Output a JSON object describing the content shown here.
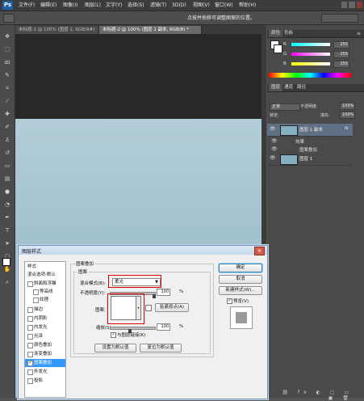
{
  "app": {
    "logo": "Ps"
  },
  "menu": [
    "文件(F)",
    "编辑(E)",
    "图像(I)",
    "图层(L)",
    "文字(Y)",
    "选择(S)",
    "滤镜(T)",
    "3D(D)",
    "视图(V)",
    "窗口(W)",
    "帮助(H)"
  ],
  "options_hint": "点按并拖移可调整图案的位置。",
  "doc_tabs": [
    "未标题-1 @ 100% (图层 1, RGB/8#)",
    "未标题-2 @ 100% (图层 1 副本, RGB/8) *"
  ],
  "color_panel": {
    "tabs": [
      "颜色",
      "色板"
    ],
    "rows": [
      {
        "letter": "R",
        "value": "255"
      },
      {
        "letter": "G",
        "value": "255"
      },
      {
        "letter": "B",
        "value": "255"
      }
    ]
  },
  "layers_panel": {
    "tabs": [
      "图层",
      "通道",
      "路径"
    ],
    "blend_mode": "正常",
    "opacity_label": "不透明度:",
    "opacity_value": "100%",
    "lock_label": "锁定:",
    "fill_label": "填充:",
    "fill_value": "100%",
    "layers": [
      {
        "name": "图层 1 副本",
        "fx": "fx",
        "selected": true
      },
      {
        "name": "效果",
        "indent": true
      },
      {
        "name": "图案叠加",
        "indent": true
      },
      {
        "name": "图层 1",
        "selected": false
      }
    ]
  },
  "dialog": {
    "title": "图层样式",
    "styles_header": "样式",
    "styles_sub": "混合选项:默认",
    "styles": [
      {
        "label": "斜面和浮雕",
        "checked": false
      },
      {
        "label": "等高线",
        "checked": false,
        "indent": true
      },
      {
        "label": "纹理",
        "checked": false,
        "indent": true
      },
      {
        "label": "描边",
        "checked": false
      },
      {
        "label": "内阴影",
        "checked": false
      },
      {
        "label": "内发光",
        "checked": false
      },
      {
        "label": "光泽",
        "checked": false
      },
      {
        "label": "颜色叠加",
        "checked": false
      },
      {
        "label": "渐变叠加",
        "checked": false
      },
      {
        "label": "图案叠加",
        "checked": true,
        "selected": true
      },
      {
        "label": "外发光",
        "checked": false
      },
      {
        "label": "投影",
        "checked": false
      }
    ],
    "section_title": "图案叠加",
    "group_title": "图案",
    "blend_label": "混合模式(B):",
    "blend_value": "柔光",
    "opacity_label": "不透明度(Y):",
    "opacity_value": "100",
    "opacity_unit": "%",
    "pattern_label": "图案:",
    "snap_button": "贴紧原点(A)",
    "scale_label": "缩放(S):",
    "scale_value": "100",
    "scale_unit": "%",
    "link_label": "与图层链接(K)",
    "default_button": "设置为默认值",
    "reset_button": "复位为默认值",
    "ok_button": "确定",
    "cancel_button": "取消",
    "new_style_button": "新建样式(W)...",
    "preview_label": "预览(V)"
  },
  "colors": {
    "accent": "#3399ff",
    "highlight": "#d00000",
    "canvas": "#a6c4d0"
  }
}
